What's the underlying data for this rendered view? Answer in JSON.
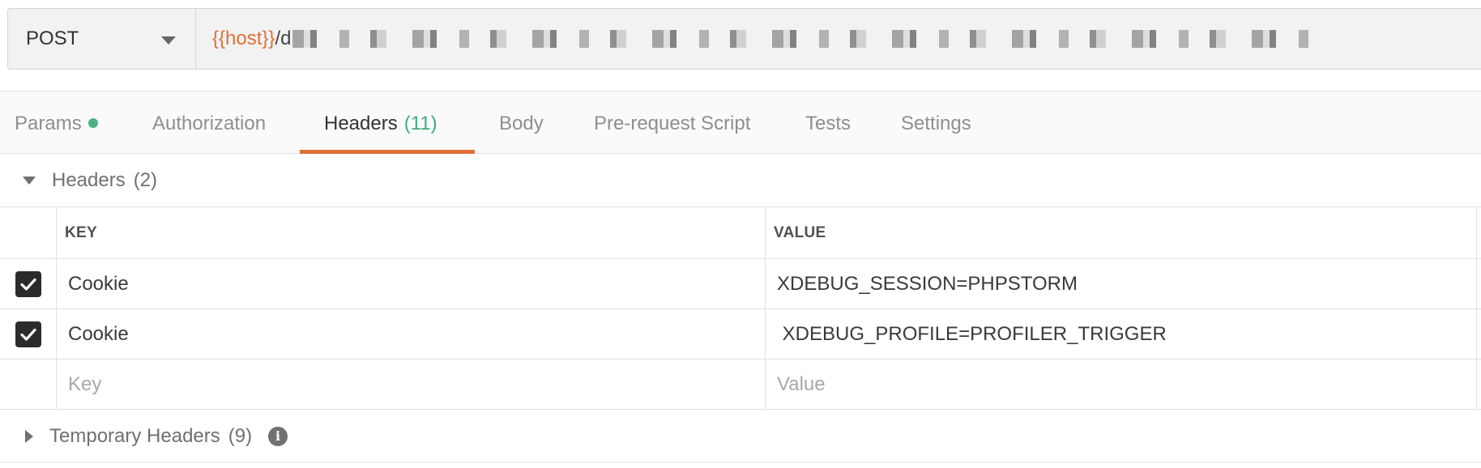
{
  "request": {
    "method": "POST",
    "url_host": "{{host}}",
    "url_rest": "/d"
  },
  "tabs": [
    {
      "label": "Params",
      "count": ""
    },
    {
      "label": "Authorization",
      "count": ""
    },
    {
      "label": "Headers",
      "count": "(11)"
    },
    {
      "label": "Body",
      "count": ""
    },
    {
      "label": "Pre-request Script",
      "count": ""
    },
    {
      "label": "Tests",
      "count": ""
    },
    {
      "label": "Settings",
      "count": ""
    }
  ],
  "active_tab": "Headers",
  "headers_section": {
    "title": "Headers",
    "count": "(2)",
    "columns": {
      "key": "KEY",
      "value": "VALUE"
    },
    "rows": [
      {
        "checked": true,
        "key": "Cookie",
        "value": "XDEBUG_SESSION=PHPSTORM"
      },
      {
        "checked": true,
        "key": "Cookie",
        "value": " XDEBUG_PROFILE=PROFILER_TRIGGER"
      }
    ],
    "placeholder": {
      "key": "Key",
      "value": "Value"
    }
  },
  "temporary_section": {
    "title": "Temporary Headers",
    "count": "(9)",
    "info_icon": "i"
  },
  "colors": {
    "accent": "#e2703a",
    "count_green": "#3fae7a",
    "params_dot": "#4db380"
  },
  "icons": {
    "method_dropdown": "chevron-down-icon",
    "section_expanded": "caret-down-icon",
    "section_collapsed": "caret-right-icon",
    "checkbox": "checkmark-icon",
    "info": "info-icon"
  }
}
